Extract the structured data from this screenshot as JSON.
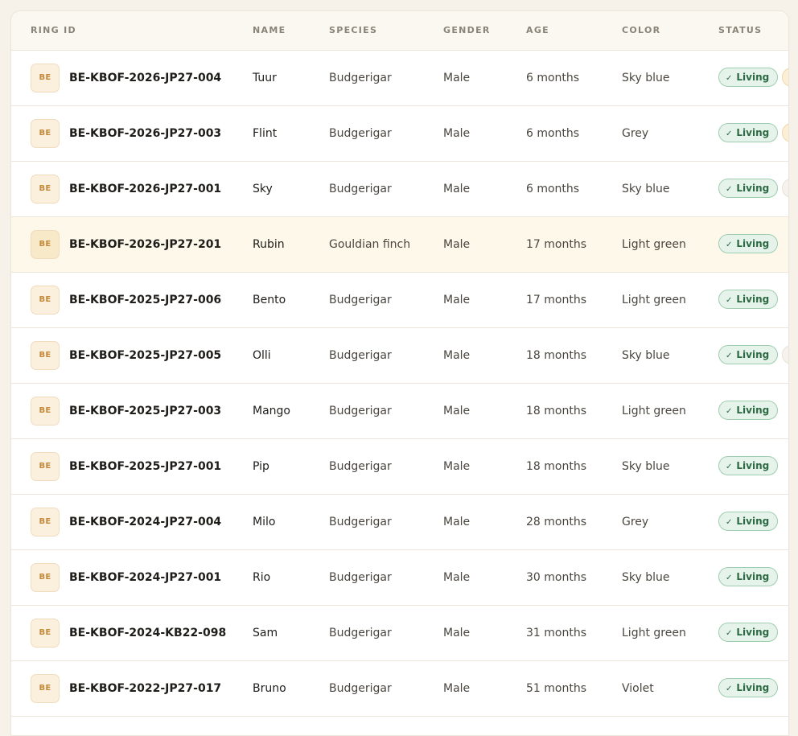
{
  "table": {
    "headers": {
      "ring_id": "RING ID",
      "name": "NAME",
      "species": "SPECIES",
      "gender": "GENDER",
      "age": "AGE",
      "color": "COLOR",
      "status": "STATUS"
    },
    "rows": [
      {
        "badge": "BE",
        "ring_id": "BE-KBOF-2026-JP27-004",
        "name": "Tuur",
        "species": "Budgerigar",
        "gender": "Male",
        "age": "6 months",
        "color": "Sky blue",
        "status": "Living",
        "extra": "tag",
        "highlighted": false
      },
      {
        "badge": "BE",
        "ring_id": "BE-KBOF-2026-JP27-003",
        "name": "Flint",
        "species": "Budgerigar",
        "gender": "Male",
        "age": "6 months",
        "color": "Grey",
        "status": "Living",
        "extra": "tag",
        "highlighted": false
      },
      {
        "badge": "BE",
        "ring_id": "BE-KBOF-2026-JP27-001",
        "name": "Sky",
        "species": "Budgerigar",
        "gender": "Male",
        "age": "6 months",
        "color": "Sky blue",
        "status": "Living",
        "extra": "faint",
        "highlighted": false
      },
      {
        "badge": "BE",
        "ring_id": "BE-KBOF-2026-JP27-201",
        "name": "Rubin",
        "species": "Gouldian finch",
        "gender": "Male",
        "age": "17 months",
        "color": "Light green",
        "status": "Living",
        "extra": "",
        "highlighted": true
      },
      {
        "badge": "BE",
        "ring_id": "BE-KBOF-2025-JP27-006",
        "name": "Bento",
        "species": "Budgerigar",
        "gender": "Male",
        "age": "17 months",
        "color": "Light green",
        "status": "Living",
        "extra": "",
        "highlighted": false
      },
      {
        "badge": "BE",
        "ring_id": "BE-KBOF-2025-JP27-005",
        "name": "Olli",
        "species": "Budgerigar",
        "gender": "Male",
        "age": "18 months",
        "color": "Sky blue",
        "status": "Living",
        "extra": "faint",
        "highlighted": false
      },
      {
        "badge": "BE",
        "ring_id": "BE-KBOF-2025-JP27-003",
        "name": "Mango",
        "species": "Budgerigar",
        "gender": "Male",
        "age": "18 months",
        "color": "Light green",
        "status": "Living",
        "extra": "",
        "highlighted": false
      },
      {
        "badge": "BE",
        "ring_id": "BE-KBOF-2025-JP27-001",
        "name": "Pip",
        "species": "Budgerigar",
        "gender": "Male",
        "age": "18 months",
        "color": "Sky blue",
        "status": "Living",
        "extra": "",
        "highlighted": false
      },
      {
        "badge": "BE",
        "ring_id": "BE-KBOF-2024-JP27-004",
        "name": "Milo",
        "species": "Budgerigar",
        "gender": "Male",
        "age": "28 months",
        "color": "Grey",
        "status": "Living",
        "extra": "",
        "highlighted": false
      },
      {
        "badge": "BE",
        "ring_id": "BE-KBOF-2024-JP27-001",
        "name": "Rio",
        "species": "Budgerigar",
        "gender": "Male",
        "age": "30 months",
        "color": "Sky blue",
        "status": "Living",
        "extra": "",
        "highlighted": false
      },
      {
        "badge": "BE",
        "ring_id": "BE-KBOF-2024-KB22-098",
        "name": "Sam",
        "species": "Budgerigar",
        "gender": "Male",
        "age": "31 months",
        "color": "Light green",
        "status": "Living",
        "extra": "",
        "highlighted": false
      },
      {
        "badge": "BE",
        "ring_id": "BE-KBOF-2022-JP27-017",
        "name": "Bruno",
        "species": "Budgerigar",
        "gender": "Male",
        "age": "51 months",
        "color": "Violet",
        "status": "Living",
        "extra": "",
        "highlighted": false
      }
    ]
  },
  "icons": {
    "status_check": "check-icon"
  },
  "colors": {
    "status_bg": "#e6f3ea",
    "status_border": "#9fcdaf",
    "status_text": "#2c6a44",
    "badge_text": "#c48a3c",
    "highlight_row": "#fdf8ea"
  }
}
